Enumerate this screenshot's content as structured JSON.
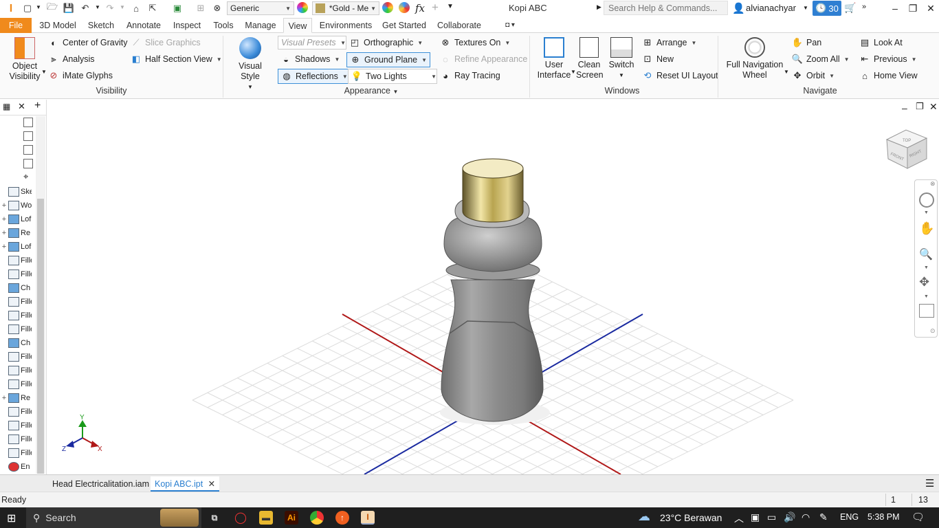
{
  "titlebar": {
    "app_letter": "I",
    "visual_style_combo": "Generic",
    "material_combo": "*Gold - Me",
    "fx_label": "fx",
    "window_title": "Kopi ABC",
    "search_placeholder": "Search Help & Commands...",
    "user": "alvianachyar",
    "clock_count": "30"
  },
  "tabs": [
    "File",
    "3D Model",
    "Sketch",
    "Annotate",
    "Inspect",
    "Tools",
    "Manage",
    "View",
    "Environments",
    "Get Started",
    "Collaborate"
  ],
  "active_tab": "View",
  "ribbon": {
    "visibility": {
      "object_visibility": "Object Visibility",
      "center_of_gravity": "Center of Gravity",
      "analysis": "Analysis",
      "imate_glyphs": "iMate Glyphs",
      "slice_graphics": "Slice Graphics",
      "half_section_view": "Half Section View",
      "group": "Visibility"
    },
    "appearance": {
      "visual_style": "Visual Style",
      "visual_presets": "Visual Presets",
      "shadows": "Shadows",
      "reflections": "Reflections",
      "orthographic": "Orthographic",
      "ground_plane": "Ground Plane",
      "two_lights": "Two Lights",
      "textures_on": "Textures On",
      "refine_appearance": "Refine Appearance",
      "ray_tracing": "Ray Tracing",
      "group": "Appearance"
    },
    "windows": {
      "user_interface": "User Interface",
      "clean_screen": "Clean Screen",
      "switch": "Switch",
      "arrange": "Arrange",
      "new": "New",
      "reset_ui_layout": "Reset UI Layout",
      "group": "Windows"
    },
    "navigate": {
      "full_navigation_wheel": "Full Navigation Wheel",
      "pan": "Pan",
      "zoom_all": "Zoom All",
      "orbit": "Orbit",
      "look_at": "Look At",
      "previous": "Previous",
      "home_view": "Home View",
      "group": "Navigate"
    }
  },
  "browser": {
    "items": [
      "Ske",
      "Wo",
      "Lof",
      "Re",
      "Lof",
      "Fille",
      "Fille",
      "Ch",
      "Fille",
      "Fille",
      "Fille",
      "Ch",
      "Fille",
      "Fille",
      "Fille",
      "Re",
      "Fille",
      "Fille",
      "Fille",
      "Fille",
      "En"
    ]
  },
  "viewcube": {
    "top": "TOP",
    "front": "FRONT",
    "right": "RIGHT"
  },
  "axis_labels": {
    "x": "X",
    "y": "Y",
    "z": "Z"
  },
  "doc_tabs": [
    "Head Electricalitation.iam",
    "Kopi ABC.ipt"
  ],
  "active_doc": "Kopi ABC.ipt",
  "status": {
    "text": "Ready",
    "count1": "1",
    "count2": "13"
  },
  "taskbar": {
    "search": "Search",
    "weather": "23°C  Berawan",
    "lang": "ENG",
    "time": "5:38 PM"
  },
  "colors": {
    "file_tab": "#f08a1c",
    "accent": "#2a7fd0",
    "x_axis": "#b01818",
    "z_axis": "#1a2aa0",
    "y_axis": "#1a9a1a",
    "cap_gold": "#c9b86a"
  }
}
